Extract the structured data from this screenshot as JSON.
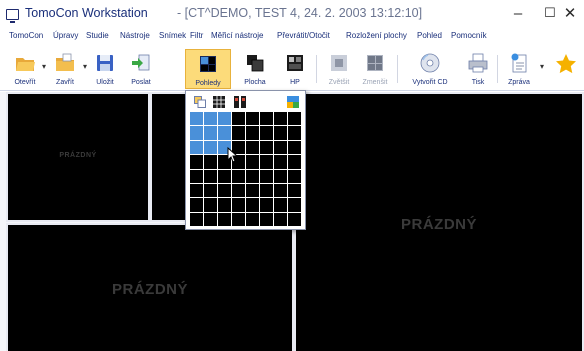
{
  "window": {
    "app_name": "TomoCon Workstation",
    "title_detail": "- [CT^DEMO, TEST 4, 24. 2. 2003 13:12:10]",
    "minimize": "–",
    "maximize": "☐",
    "close": "✕"
  },
  "menu": {
    "items": [
      "TomoCon",
      "Úpravy",
      "Studie",
      "Nástroje",
      "Snímek",
      "Filtr",
      "Měřicí nástroje",
      "Převrátit/Otočit",
      "Rozložení plochy",
      "Pohled",
      "Pomocník"
    ]
  },
  "toolbar": {
    "buttons": [
      {
        "label": "Otevřít",
        "icon": "folder-open-icon",
        "enabled": true
      },
      {
        "label": "Zavřít",
        "icon": "folder-close-icon",
        "enabled": true
      },
      {
        "label": "Uložit",
        "icon": "floppy-disk-icon",
        "enabled": true
      },
      {
        "label": "Poslat",
        "icon": "send-icon",
        "enabled": true
      },
      {
        "label": "Pohledy",
        "icon": "views-layout-icon",
        "enabled": true,
        "active": true
      },
      {
        "label": "Plocha",
        "icon": "desktop-layout-icon",
        "enabled": true
      },
      {
        "label": "HP",
        "icon": "hanging-protocol-icon",
        "enabled": true
      },
      {
        "label": "Zvětšit",
        "icon": "zoom-in-icon",
        "enabled": false
      },
      {
        "label": "Zmenšit",
        "icon": "zoom-out-icon",
        "enabled": false
      },
      {
        "label": "Vytvořit CD",
        "icon": "cd-icon",
        "enabled": true
      },
      {
        "label": "Tisk",
        "icon": "printer-icon",
        "enabled": true
      },
      {
        "label": "Zpráva",
        "icon": "report-icon",
        "enabled": true
      }
    ],
    "accent_active": "#fcdb7a"
  },
  "panes": {
    "empty_label": "PRÁZDNÝ"
  },
  "layout_picker": {
    "grid_rows": 8,
    "grid_cols": 8,
    "selected_rows": 3,
    "selected_cols": 3,
    "selection_color": "#4a90d9"
  }
}
